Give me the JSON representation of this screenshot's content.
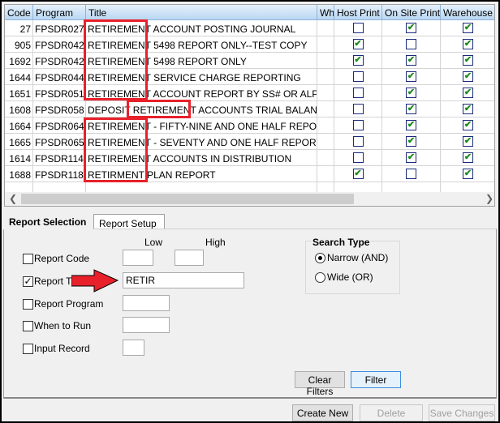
{
  "grid": {
    "columns": [
      "Code",
      "Program",
      "Title",
      "Wh",
      "Host Print",
      "On Site Print",
      "Warehouse p"
    ],
    "rows": [
      {
        "code": "27",
        "program": "FPSDR027",
        "title": "RETIREMENT ACCOUNT POSTING JOURNAL",
        "host": false,
        "onsite": true,
        "warehouse": true
      },
      {
        "code": "905",
        "program": "FPSDR042",
        "title": "RETIREMENT 5498 REPORT ONLY--TEST COPY",
        "host": true,
        "onsite": false,
        "warehouse": true
      },
      {
        "code": "1692",
        "program": "FPSDR042",
        "title": "RETIREMENT 5498 REPORT ONLY",
        "host": true,
        "onsite": true,
        "warehouse": true
      },
      {
        "code": "1644",
        "program": "FPSDR044",
        "title": "RETIREMENT SERVICE CHARGE REPORTING",
        "host": false,
        "onsite": true,
        "warehouse": true
      },
      {
        "code": "1651",
        "program": "FPSDR051",
        "title": "RETIREMENT ACCOUNT REPORT BY SS# OR ALPHA",
        "host": false,
        "onsite": true,
        "warehouse": true
      },
      {
        "code": "1608",
        "program": "FPSDR058",
        "title": "DEPOSIT RETIREMENT ACCOUNTS TRIAL BALANCE",
        "host": false,
        "onsite": true,
        "warehouse": true
      },
      {
        "code": "1664",
        "program": "FPSDR064",
        "title": "RETIREMENT - FIFTY-NINE AND ONE HALF REPORT",
        "host": false,
        "onsite": true,
        "warehouse": true
      },
      {
        "code": "1665",
        "program": "FPSDR065",
        "title": "RETIREMENT - SEVENTY AND ONE HALF REPORT",
        "host": false,
        "onsite": true,
        "warehouse": true
      },
      {
        "code": "1614",
        "program": "FPSDR114",
        "title": "RETIREMENT ACCOUNTS IN DISTRIBUTION",
        "host": false,
        "onsite": true,
        "warehouse": true
      },
      {
        "code": "1688",
        "program": "FPSDR118",
        "title": "RETIRMENT PLAN REPORT",
        "host": true,
        "onsite": false,
        "warehouse": true
      }
    ]
  },
  "tabs": [
    "Report Selection",
    "Report Setup"
  ],
  "filters": {
    "low_label": "Low",
    "high_label": "High",
    "items": [
      {
        "label": "Report Code",
        "checked": false,
        "low": "",
        "high": ""
      },
      {
        "label": "Report Title",
        "checked": true,
        "value": "RETIR"
      },
      {
        "label": "Report Program",
        "checked": false,
        "value": ""
      },
      {
        "label": "When to Run",
        "checked": false,
        "value": ""
      },
      {
        "label": "Input Record",
        "checked": false,
        "value": ""
      }
    ]
  },
  "search_type": {
    "title": "Search Type",
    "options": [
      {
        "label": "Narrow (AND)",
        "selected": true
      },
      {
        "label": "Wide (OR)",
        "selected": false
      }
    ]
  },
  "buttons": {
    "clear": "Clear Filters",
    "filter": "Filter",
    "create": "Create New",
    "delete": "Delete",
    "save": "Save Changes"
  },
  "colors": {
    "highlight": "#e8202a",
    "check": "#1a8a1a"
  }
}
